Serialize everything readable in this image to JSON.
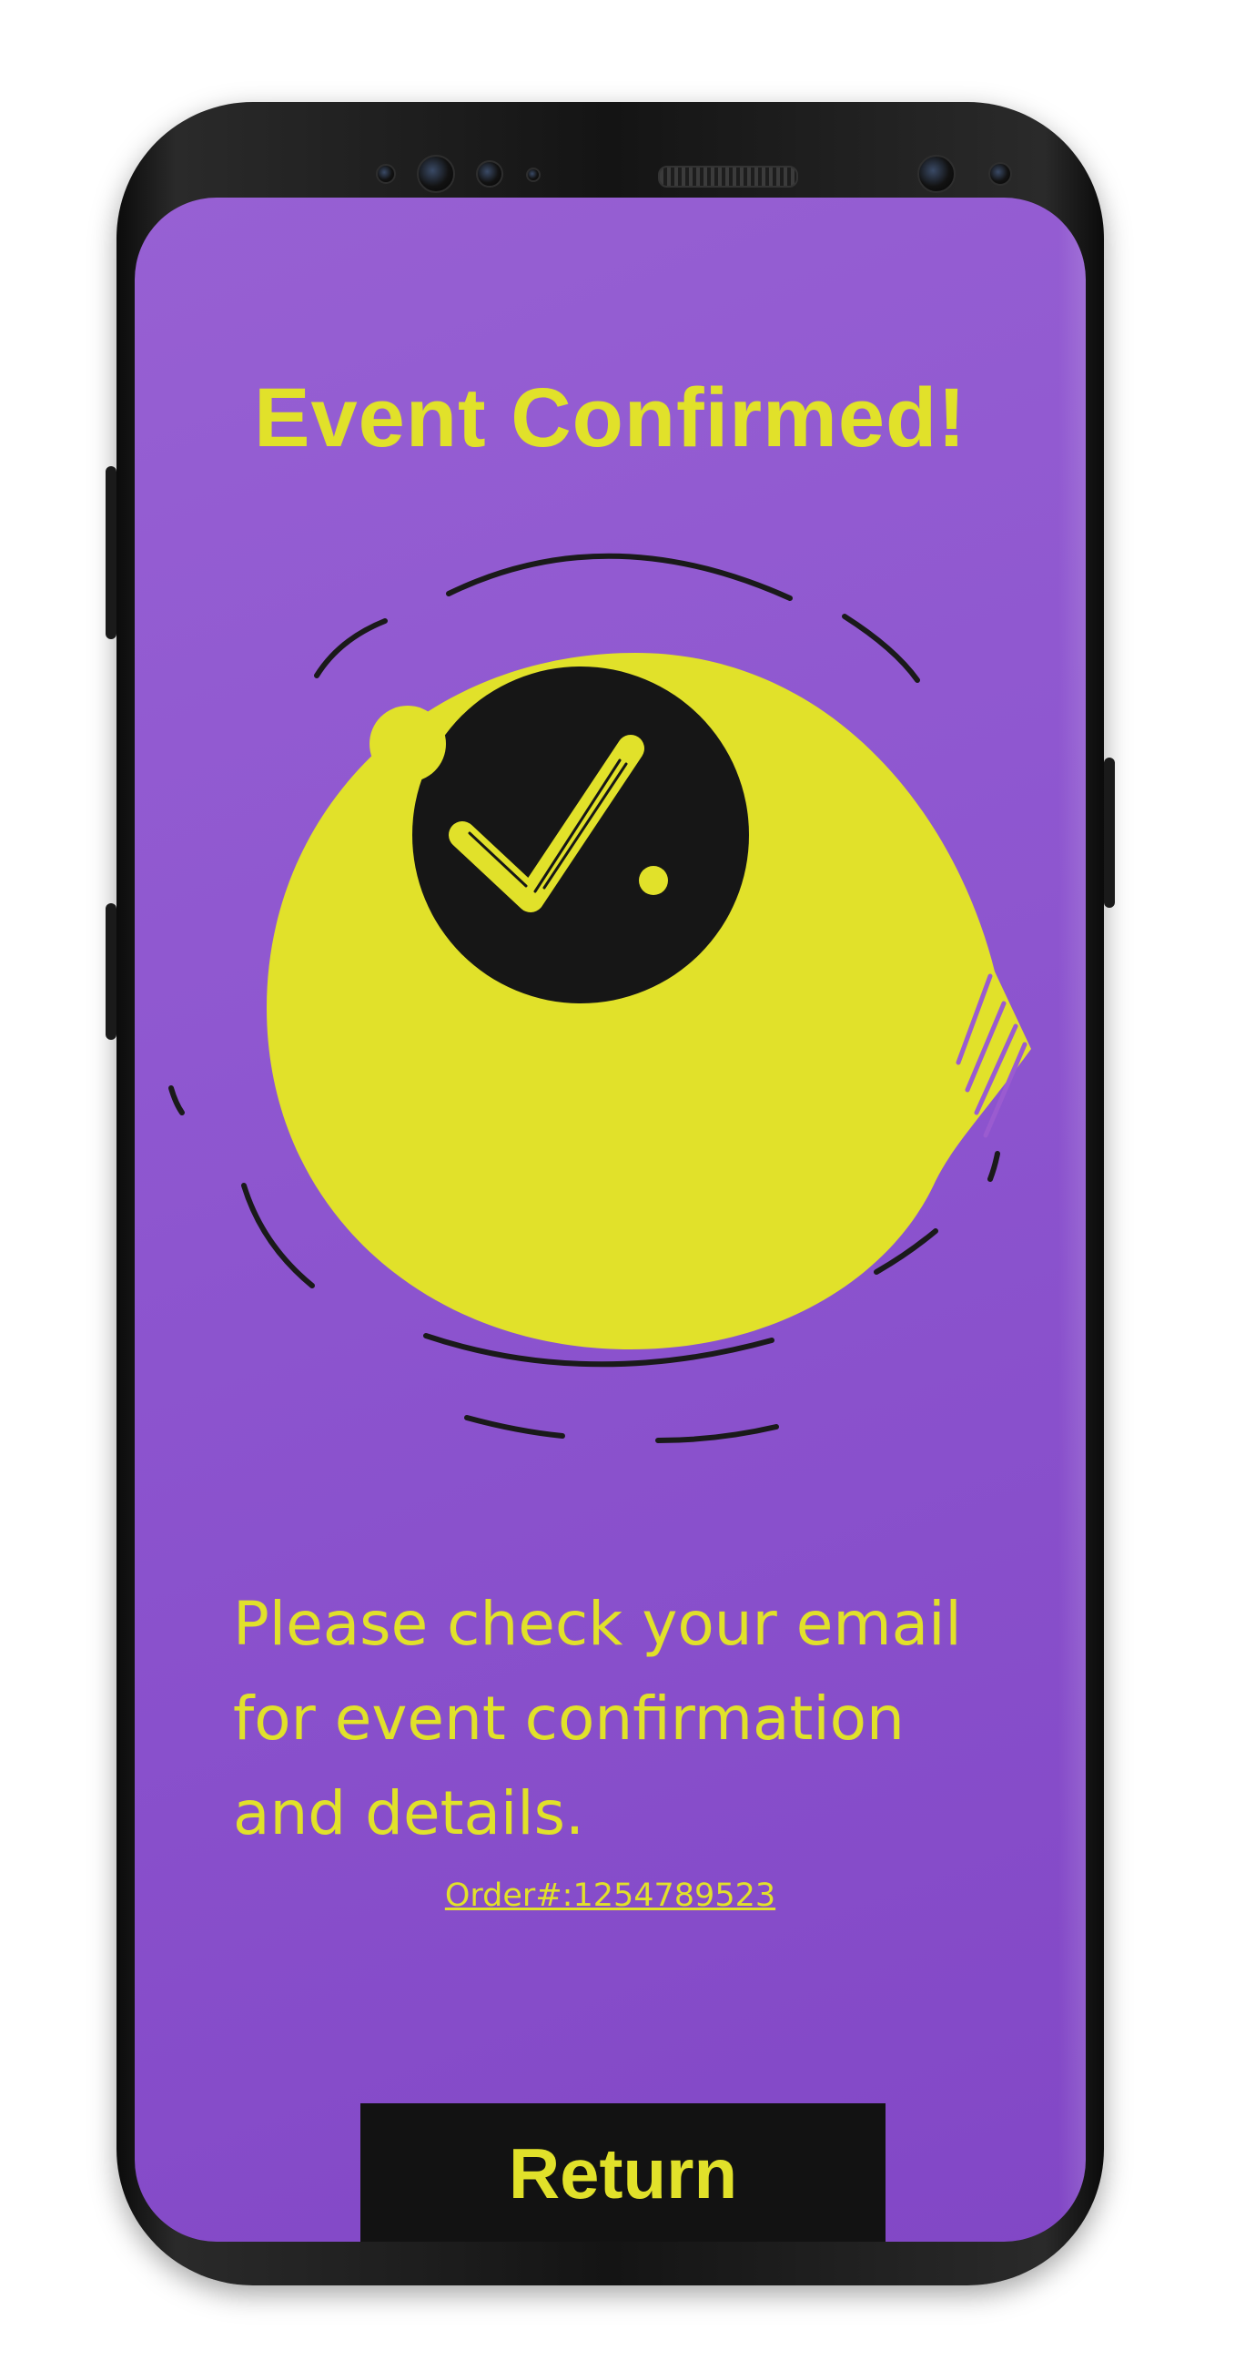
{
  "screen": {
    "title": "Event Confirmed!",
    "message": "Please check your email for event confirmation and details.",
    "order_link": "Order#:1254789523",
    "return_label": "Return"
  },
  "illustration": {
    "icon": "checkmark-circle-icon"
  },
  "colors": {
    "background": "#8d55cf",
    "accent": "#e1e12a",
    "dark": "#121212"
  }
}
